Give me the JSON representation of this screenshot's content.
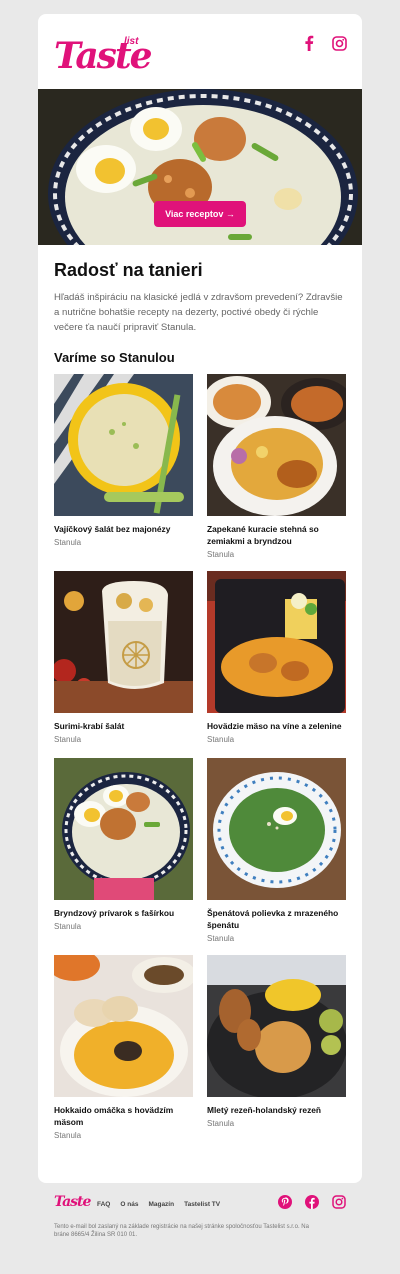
{
  "brand": {
    "logo_main": "Taste",
    "logo_sub": "list",
    "accent": "#e0127a"
  },
  "header": {
    "social": [
      {
        "icon": "facebook-icon"
      },
      {
        "icon": "instagram-icon"
      }
    ]
  },
  "hero": {
    "cta_label": "Viac receptov →"
  },
  "content": {
    "title": "Radosť na tanieri",
    "intro": "Hľadáš inšpiráciu na klasické jedlá v zdravšom prevedení? Zdravšie a nutrične bohatšie recepty na dezerty, poctivé obedy či rýchle večere ťa naučí pripraviť Stanula.",
    "section_title": "Varíme so Stanulou"
  },
  "recipes": [
    {
      "name": "Vajíčkový šalát bez majonézy",
      "author": "Stanula"
    },
    {
      "name": "Zapekané kuracie stehná so zemiakmi a bryndzou",
      "author": "Stanula"
    },
    {
      "name": "Surimi-krabí šalát",
      "author": "Stanula"
    },
    {
      "name": "Hovädzie mäso na víne a zelenine",
      "author": "Stanula"
    },
    {
      "name": "Bryndzový prívarok s fašírkou",
      "author": "Stanula"
    },
    {
      "name": "Špenátová polievka z mrazeného špenátu",
      "author": "Stanula"
    },
    {
      "name": "Hokkaido omáčka s hovädzím mäsom",
      "author": "Stanula"
    },
    {
      "name": "Mletý rezeň-holandský rezeň",
      "author": "Stanula"
    }
  ],
  "footer": {
    "logo": "Taste",
    "links": [
      "FAQ",
      "O nás",
      "Magazín",
      "Tastelist TV"
    ],
    "social": [
      {
        "icon": "pinterest-icon"
      },
      {
        "icon": "facebook-icon"
      },
      {
        "icon": "instagram-icon"
      }
    ],
    "note": "Tento e-mail bol zaslaný na základe registrácie na našej stránke spoločnosťou Tastelist s.r.o. Na bráne 8665/4 Žilina SR 010 01."
  }
}
